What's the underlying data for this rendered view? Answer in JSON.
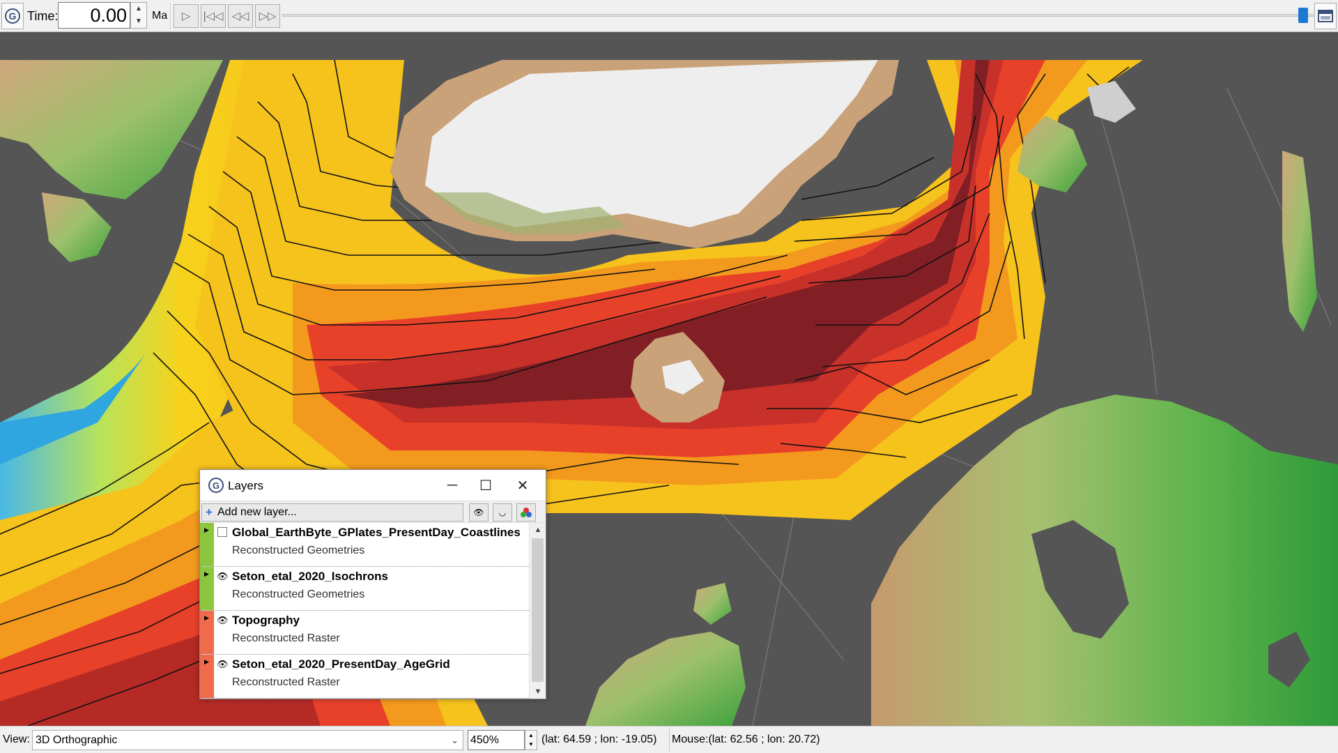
{
  "toolbar": {
    "time_label": "Time:",
    "time_value": "0.00",
    "time_unit": "Ma",
    "buttons": [
      "play",
      "reset-to-start",
      "step-back",
      "step-forward"
    ],
    "slider_position": 1.0
  },
  "layers_dialog": {
    "title": "Layers",
    "add_layer_label": "Add new layer...",
    "layers": [
      {
        "name": "Global_EarthByte_GPlates_PresentDay_Coastlines",
        "type": "Reconstructed Geometries",
        "visible": false,
        "color": "#8cc63f"
      },
      {
        "name": "Seton_etal_2020_Isochrons",
        "type": "Reconstructed Geometries",
        "visible": true,
        "color": "#8cc63f"
      },
      {
        "name": "Topography",
        "type": "Reconstructed Raster",
        "visible": true,
        "color": "#ef6b4a"
      },
      {
        "name": "Seton_etal_2020_PresentDay_AgeGrid",
        "type": "Reconstructed Raster",
        "visible": true,
        "color": "#ef6b4a"
      }
    ]
  },
  "statusbar": {
    "view_label": "View:",
    "view_value": "3D Orthographic",
    "zoom_value": "450%",
    "camera_coords": "(lat: 64.59 ; lon: -19.05)",
    "mouse_coords": "Mouse:(lat: 62.56 ; lon: 20.72)"
  },
  "colors": {
    "ocean_background": "#555555",
    "age_young": "#7a1e23",
    "age_mid": "#e8412a",
    "age_old": "#f6c21c",
    "ice": "#f2f2f2",
    "land_low": "#3aa63a",
    "land_high": "#c9a27a"
  }
}
